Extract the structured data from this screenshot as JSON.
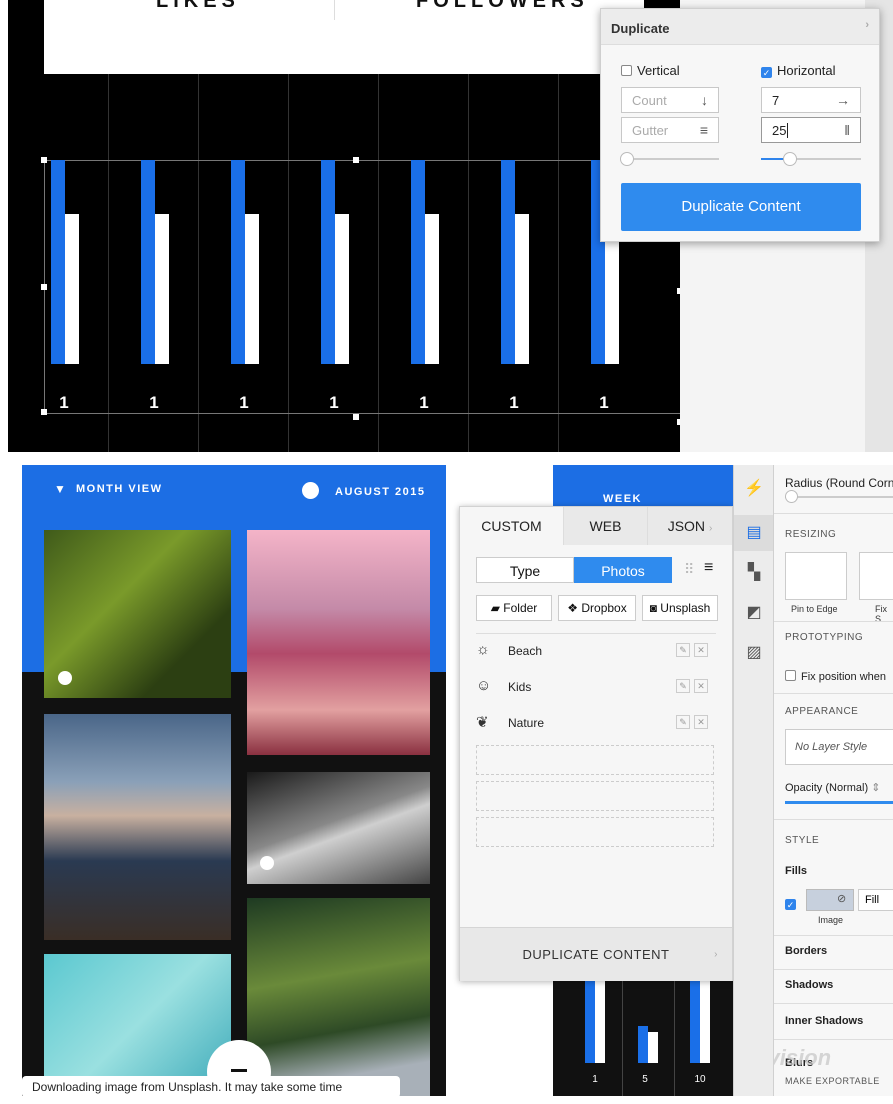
{
  "top": {
    "header_left": "LIKES",
    "header_right": "FOLLOWERS",
    "bar_labels": [
      "1",
      "1",
      "1",
      "1",
      "1",
      "1",
      "1"
    ]
  },
  "duplicate_panel": {
    "title": "Duplicate",
    "vertical_label": "Vertical",
    "horizontal_label": "Horizontal",
    "vertical_checked": false,
    "horizontal_checked": true,
    "count_placeholder": "Count",
    "gutter_placeholder": "Gutter",
    "count_value": "7",
    "gutter_value": "25",
    "button_label": "Duplicate Content"
  },
  "app": {
    "month_view": "MONTH VIEW",
    "date_label": "AUGUST 2015",
    "week_label": "WEEK",
    "week_values": [
      "1",
      "5",
      "10"
    ],
    "toast": "Downloading image from Unsplash. It may take some time"
  },
  "craft": {
    "tabs": [
      "CUSTOM",
      "WEB",
      "JSON"
    ],
    "seg_type": "Type",
    "seg_photos": "Photos",
    "btn_folder": "Folder",
    "btn_dropbox": "Dropbox",
    "btn_unsplash": "Unsplash",
    "items": [
      "Beach",
      "Kids",
      "Nature"
    ],
    "footer": "DUPLICATE CONTENT"
  },
  "inspector": {
    "radius": "Radius (Round Corne",
    "resizing": "RESIZING",
    "pin_to_edge": "Pin to Edge",
    "fix_size": "Fix S",
    "prototyping": "PROTOTYPING",
    "fix_position": "Fix position when",
    "appearance": "APPEARANCE",
    "no_layer_style": "No Layer Style",
    "opacity": "Opacity (Normal)",
    "style": "STYLE",
    "fills": "Fills",
    "fill_type": "Fill",
    "image_label": "Image",
    "borders": "Borders",
    "shadows": "Shadows",
    "inner_shadows": "Inner Shadows",
    "blurs": "Blurs",
    "make_exportable": "MAKE EXPORTABLE",
    "watermark": "invision"
  },
  "colors": {
    "accent": "#1c6ee4",
    "button": "#2f8bee"
  }
}
